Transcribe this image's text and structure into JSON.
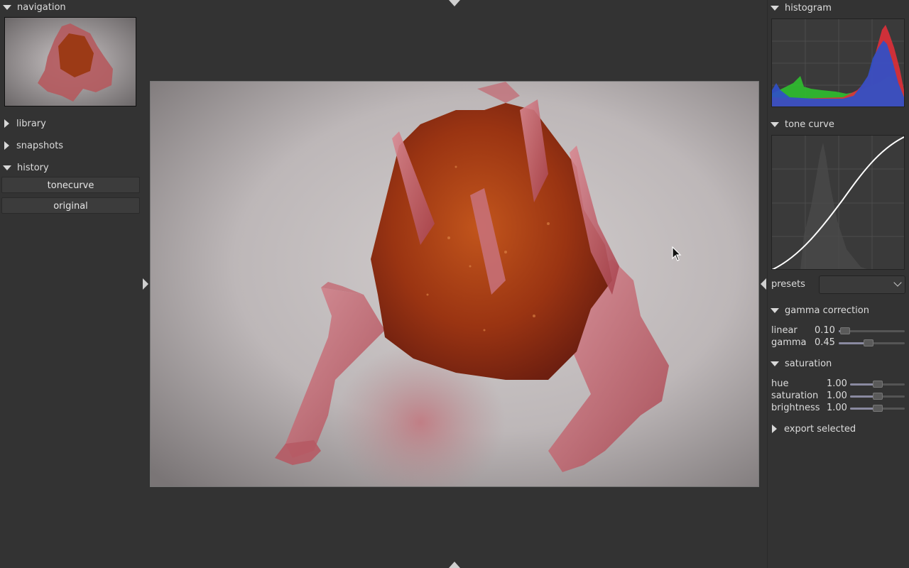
{
  "left_panel": {
    "navigation": {
      "label": "navigation"
    },
    "library": {
      "label": "library"
    },
    "snapshots": {
      "label": "snapshots"
    },
    "history": {
      "label": "history",
      "items": [
        {
          "label": "tonecurve"
        },
        {
          "label": "original"
        }
      ]
    }
  },
  "right_panel": {
    "histogram": {
      "label": "histogram"
    },
    "tone_curve": {
      "label": "tone curve"
    },
    "presets": {
      "label": "presets",
      "value": ""
    },
    "gamma_correction": {
      "label": "gamma correction",
      "linear": {
        "label": "linear",
        "value": "0.10",
        "fraction": 0.1
      },
      "gamma": {
        "label": "gamma",
        "value": "0.45",
        "fraction": 0.45
      }
    },
    "saturation": {
      "label": "saturation",
      "hue": {
        "label": "hue",
        "value": "1.00",
        "fraction": 0.5
      },
      "saturation": {
        "label": "saturation",
        "value": "1.00",
        "fraction": 0.5
      },
      "brightness": {
        "label": "brightness",
        "value": "1.00",
        "fraction": 0.5
      }
    },
    "export_selected": {
      "label": "export selected"
    }
  },
  "colors": {
    "background": "#333333",
    "panel_text": "#dcdcdc",
    "slider_fill": "#8a8aa0",
    "histogram_red": "#e0303a",
    "histogram_green": "#2fc02f",
    "histogram_blue": "#3050c8"
  },
  "icons": [
    "expander-down-icon",
    "expander-right-icon",
    "panel-collapse-arrow-icon",
    "dropdown-chevron-icon",
    "mouse-cursor-icon"
  ]
}
